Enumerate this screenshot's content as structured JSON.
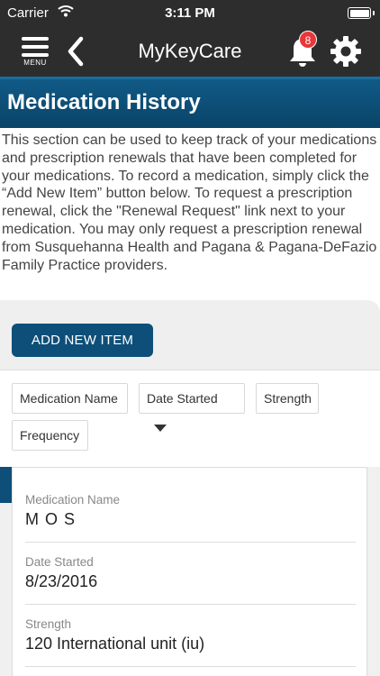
{
  "status_bar": {
    "carrier": "Carrier",
    "time": "3:11 PM",
    "icons": [
      "wifi-icon",
      "battery-icon"
    ]
  },
  "nav": {
    "menu_label": "MENU",
    "title": "MyKeyCare",
    "notification_count": "8",
    "icons": [
      "menu-icon",
      "back-chevron-icon",
      "bell-icon",
      "gear-icon"
    ]
  },
  "page": {
    "title": "Medication History",
    "intro": "This section can be used to keep track of your medications and prescription renewals that have been completed for your medications. To record a medication, simply click the “Add New Item” button below. To request a prescription renewal, click the \"Renewal Request\" link next to your medication. You may only request a prescription renewal from Susquehanna Health and Pagana & Pagana-DeFazio Family Practice providers."
  },
  "actions": {
    "add_button": "ADD NEW ITEM"
  },
  "sort": {
    "columns": [
      "Medication Name",
      "Date Started",
      "Strength",
      "Frequency"
    ],
    "active_sort": "Date Started"
  },
  "medications": [
    {
      "fields": [
        {
          "label": "Medication Name",
          "value": "M O S"
        },
        {
          "label": "Date Started",
          "value": "8/23/2016"
        },
        {
          "label": "Strength",
          "value": "120 International unit (iu)"
        }
      ]
    }
  ],
  "colors": {
    "nav_bg": "#2d2d2d",
    "header_blue": "#0a4468",
    "button_blue": "#0d4f78",
    "badge_red": "#e8373a"
  }
}
